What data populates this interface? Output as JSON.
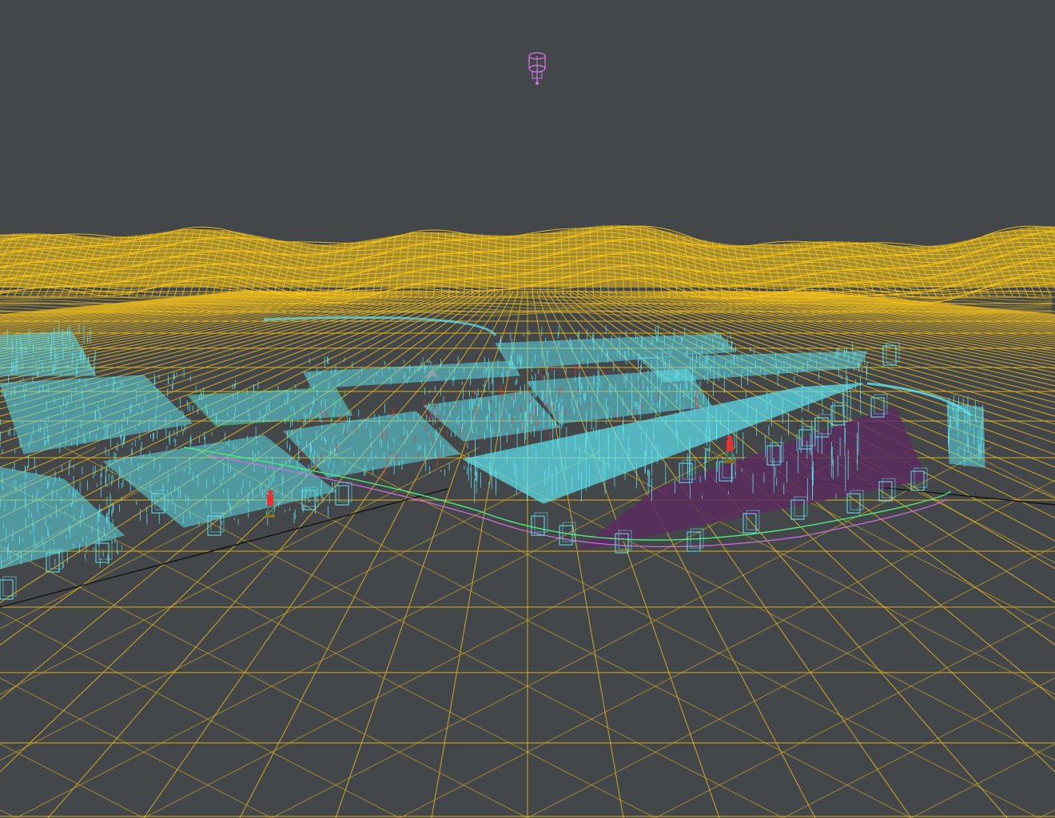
{
  "viewport": {
    "view_mode": "wireframe",
    "background_color": "#44474a"
  },
  "colors": {
    "ground_grid": "#e8b820",
    "terrain": "#f2c21b",
    "structures": "#5fe6f2",
    "outline_green": "#4ee87c",
    "outline_red": "#e8323a",
    "outline_magenta": "#d070e0",
    "pad": "#5a2b5e",
    "camera_gizmo": "#d27ae8",
    "figure": "#e83232",
    "ground_line": "#111111",
    "pivot_marker": "#9aa3a8"
  },
  "icons": {
    "camera_gizmo": "camera-icon",
    "pivot_marker": "pivot-marker-icon"
  },
  "figures": [
    {
      "name": "person-figure"
    },
    {
      "name": "person-figure"
    }
  ]
}
